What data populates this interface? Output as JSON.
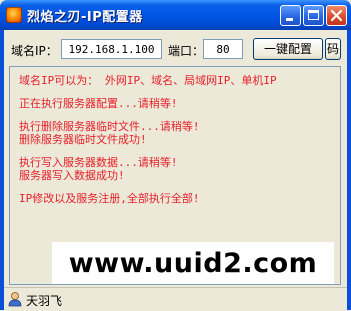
{
  "window": {
    "title": "烈焰之刃-IP配置器",
    "buttons": {
      "minimize": "minimize",
      "maximize": "maximize",
      "close": "close"
    }
  },
  "form": {
    "ip_label": "域名IP：",
    "ip_value": "192.168.1.100",
    "port_label": "端口：",
    "port_value": "80",
    "config_button": "一键配置",
    "code_button": "码"
  },
  "log": {
    "lines": [
      "域名IP可以为： 外网IP、域名、局域网IP、单机IP",
      "正在执行服务器配置...请稍等!",
      "执行删除服务器临时文件...请稍等!",
      "删除服务器临时文件成功!",
      "执行写入服务器数据...请稍等!",
      "服务器写入数据成功!",
      "IP修改以及服务注册,全部执行全部!"
    ]
  },
  "watermark": "www.uuid2.com",
  "status": {
    "icon": "user-icon",
    "text": "天羽飞"
  },
  "colors": {
    "log_text": "#e5202a",
    "titlebar": "#0054e3",
    "background": "#ece9d8"
  }
}
